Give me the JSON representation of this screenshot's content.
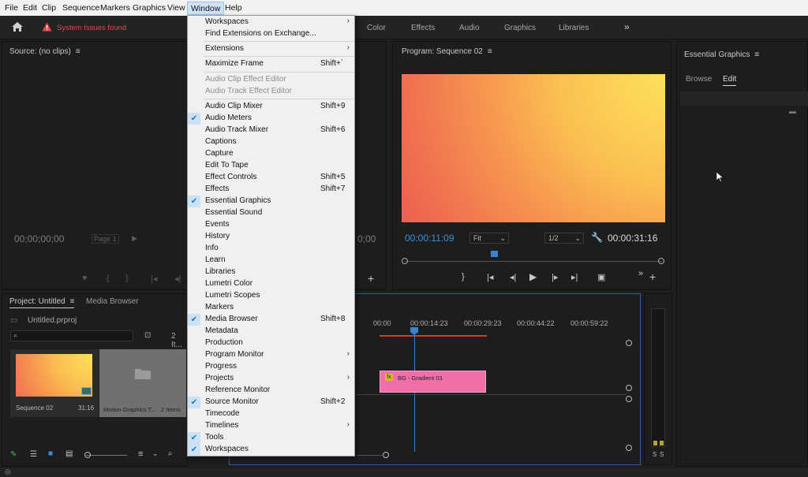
{
  "menubar": {
    "items": [
      "File",
      "Edit",
      "Clip",
      "Sequence",
      "Markers",
      "Graphics",
      "View",
      "Window",
      "Help"
    ]
  },
  "header": {
    "warning_text": "System Issues found",
    "workspace_tabs": [
      "Color",
      "Effects",
      "Audio",
      "Graphics",
      "Libraries"
    ]
  },
  "source_monitor": {
    "title": "Source: (no clips)",
    "timecode": "00;00;00;00",
    "page_label": "Page 1",
    "right_timecode": "0;00"
  },
  "program_monitor": {
    "title": "Program: Sequence 02",
    "timecode_current": "00:00:11:09",
    "fit_label": "Fit",
    "resolution_label": "1/2",
    "timecode_duration": "00:00:31:16"
  },
  "essential_graphics": {
    "title": "Essential Graphics",
    "tabs": [
      "Browse",
      "Edit"
    ]
  },
  "project": {
    "title": "Project: Untitled",
    "media_browser_tab": "Media Browser",
    "file_name": "Untitled.prproj",
    "item_count": "2 It...",
    "items": [
      {
        "name": "Sequence 02",
        "meta": "31:16"
      },
      {
        "name": "Motion Graphics T...",
        "meta": "2 Items"
      }
    ]
  },
  "timeline": {
    "ruler": [
      "00:00",
      "00:00:14:23",
      "00:00:29:23",
      "00:00:44:22",
      "00:00:59:22"
    ],
    "clip_label": "BG - Gradient 03",
    "clip_fx": "fx"
  },
  "audio_meter": {
    "labels": [
      "S",
      "S"
    ]
  },
  "window_menu": {
    "items": [
      {
        "label": "Workspaces",
        "shortcut": "",
        "submenu": true,
        "checked": false,
        "disabled": false
      },
      {
        "label": "Find Extensions on Exchange...",
        "shortcut": "",
        "submenu": false,
        "checked": false,
        "disabled": false
      },
      {
        "label": "Extensions",
        "shortcut": "",
        "submenu": true,
        "checked": false,
        "disabled": false
      },
      {
        "label": "Maximize Frame",
        "shortcut": "Shift+`",
        "submenu": false,
        "checked": false,
        "disabled": false
      },
      {
        "label": "Audio Clip Effect Editor",
        "shortcut": "",
        "submenu": false,
        "checked": false,
        "disabled": true
      },
      {
        "label": "Audio Track Effect Editor",
        "shortcut": "",
        "submenu": false,
        "checked": false,
        "disabled": true
      },
      {
        "label": "Audio Clip Mixer",
        "shortcut": "Shift+9",
        "submenu": false,
        "checked": false,
        "disabled": false
      },
      {
        "label": "Audio Meters",
        "shortcut": "",
        "submenu": false,
        "checked": true,
        "disabled": false
      },
      {
        "label": "Audio Track Mixer",
        "shortcut": "Shift+6",
        "submenu": false,
        "checked": false,
        "disabled": false
      },
      {
        "label": "Captions",
        "shortcut": "",
        "submenu": false,
        "checked": false,
        "disabled": false
      },
      {
        "label": "Capture",
        "shortcut": "",
        "submenu": false,
        "checked": false,
        "disabled": false
      },
      {
        "label": "Edit To Tape",
        "shortcut": "",
        "submenu": false,
        "checked": false,
        "disabled": false
      },
      {
        "label": "Effect Controls",
        "shortcut": "Shift+5",
        "submenu": false,
        "checked": false,
        "disabled": false
      },
      {
        "label": "Effects",
        "shortcut": "Shift+7",
        "submenu": false,
        "checked": false,
        "disabled": false
      },
      {
        "label": "Essential Graphics",
        "shortcut": "",
        "submenu": false,
        "checked": true,
        "disabled": false
      },
      {
        "label": "Essential Sound",
        "shortcut": "",
        "submenu": false,
        "checked": false,
        "disabled": false
      },
      {
        "label": "Events",
        "shortcut": "",
        "submenu": false,
        "checked": false,
        "disabled": false
      },
      {
        "label": "History",
        "shortcut": "",
        "submenu": false,
        "checked": false,
        "disabled": false
      },
      {
        "label": "Info",
        "shortcut": "",
        "submenu": false,
        "checked": false,
        "disabled": false
      },
      {
        "label": "Learn",
        "shortcut": "",
        "submenu": false,
        "checked": false,
        "disabled": false
      },
      {
        "label": "Libraries",
        "shortcut": "",
        "submenu": false,
        "checked": false,
        "disabled": false
      },
      {
        "label": "Lumetri Color",
        "shortcut": "",
        "submenu": false,
        "checked": false,
        "disabled": false
      },
      {
        "label": "Lumetri Scopes",
        "shortcut": "",
        "submenu": false,
        "checked": false,
        "disabled": false
      },
      {
        "label": "Markers",
        "shortcut": "",
        "submenu": false,
        "checked": false,
        "disabled": false
      },
      {
        "label": "Media Browser",
        "shortcut": "Shift+8",
        "submenu": false,
        "checked": true,
        "disabled": false
      },
      {
        "label": "Metadata",
        "shortcut": "",
        "submenu": false,
        "checked": false,
        "disabled": false
      },
      {
        "label": "Production",
        "shortcut": "",
        "submenu": false,
        "checked": false,
        "disabled": false
      },
      {
        "label": "Program Monitor",
        "shortcut": "",
        "submenu": true,
        "checked": false,
        "disabled": false
      },
      {
        "label": "Progress",
        "shortcut": "",
        "submenu": false,
        "checked": false,
        "disabled": false
      },
      {
        "label": "Projects",
        "shortcut": "",
        "submenu": true,
        "checked": false,
        "disabled": false
      },
      {
        "label": "Reference Monitor",
        "shortcut": "",
        "submenu": false,
        "checked": false,
        "disabled": false
      },
      {
        "label": "Source Monitor",
        "shortcut": "Shift+2",
        "submenu": false,
        "checked": true,
        "disabled": false
      },
      {
        "label": "Timecode",
        "shortcut": "",
        "submenu": false,
        "checked": false,
        "disabled": false
      },
      {
        "label": "Timelines",
        "shortcut": "",
        "submenu": true,
        "checked": false,
        "disabled": false
      },
      {
        "label": "Tools",
        "shortcut": "",
        "submenu": false,
        "checked": true,
        "disabled": false
      },
      {
        "label": "Workspaces",
        "shortcut": "",
        "submenu": false,
        "checked": true,
        "disabled": false
      }
    ]
  },
  "colors": {
    "accent_blue": "#3b8fde",
    "warning_red": "#e5474f",
    "clip_pink": "#ef6fa7",
    "playhead_blue": "#3b82d6"
  }
}
